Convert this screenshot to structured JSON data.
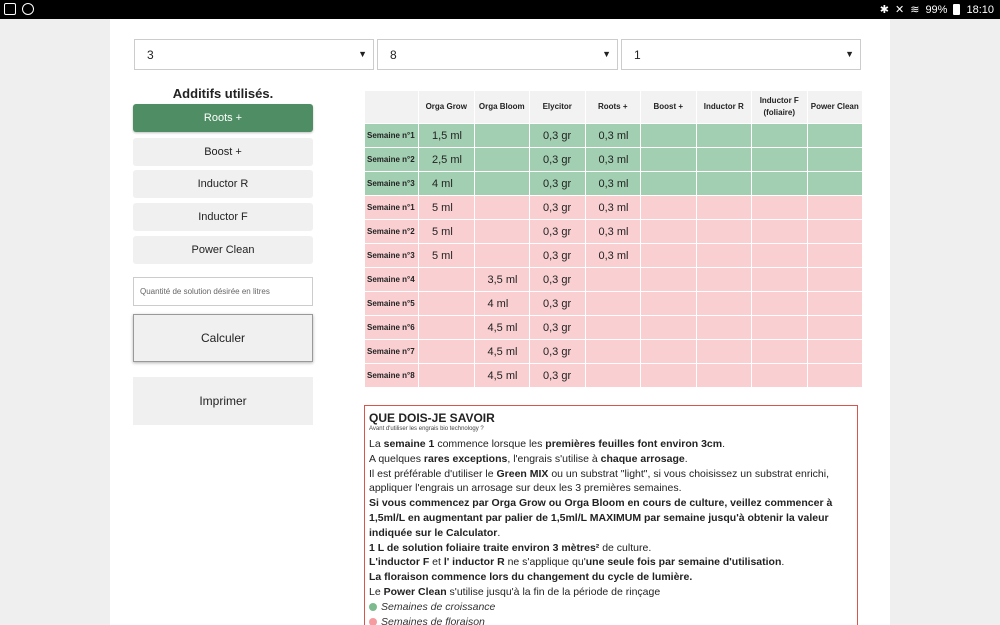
{
  "status_bar": {
    "battery": "99%",
    "time": "18:10"
  },
  "selects": {
    "s1": "3",
    "s2": "8",
    "s3": "1"
  },
  "sidebar": {
    "title": "Additifs utilisés.",
    "buttons": [
      "Roots +",
      "Boost +",
      "Inductor R",
      "Inductor F",
      "Power Clean"
    ],
    "active_index": 0,
    "quantity_placeholder": "Quantité de solution désirée en litres",
    "calculate_label": "Calculer",
    "print_label": "Imprimer"
  },
  "table": {
    "headers": [
      "Orga Grow",
      "Orga Bloom",
      "Elycitor",
      "Roots +",
      "Boost +",
      "Inductor R",
      "Inductor F (foliaire)",
      "Power Clean"
    ],
    "rows": [
      {
        "phase": "grow",
        "week": "Semaine n°1",
        "cells": [
          "1,5 ml",
          "",
          "0,3 gr",
          "0,3 ml",
          "",
          "",
          "",
          ""
        ]
      },
      {
        "phase": "grow",
        "week": "Semaine n°2",
        "cells": [
          "2,5 ml",
          "",
          "0,3 gr",
          "0,3 ml",
          "",
          "",
          "",
          ""
        ]
      },
      {
        "phase": "grow",
        "week": "Semaine n°3",
        "cells": [
          "4 ml",
          "",
          "0,3 gr",
          "0,3 ml",
          "",
          "",
          "",
          ""
        ]
      },
      {
        "phase": "flower",
        "week": "Semaine n°1",
        "cells": [
          "5 ml",
          "",
          "0,3 gr",
          "0,3 ml",
          "",
          "",
          "",
          ""
        ]
      },
      {
        "phase": "flower",
        "week": "Semaine n°2",
        "cells": [
          "5 ml",
          "",
          "0,3 gr",
          "0,3 ml",
          "",
          "",
          "",
          ""
        ]
      },
      {
        "phase": "flower",
        "week": "Semaine n°3",
        "cells": [
          "5 ml",
          "",
          "0,3 gr",
          "0,3 ml",
          "",
          "",
          "",
          ""
        ]
      },
      {
        "phase": "flower",
        "week": "Semaine n°4",
        "cells": [
          "",
          "3,5 ml",
          "0,3 gr",
          "",
          "",
          "",
          "",
          ""
        ]
      },
      {
        "phase": "flower",
        "week": "Semaine n°5",
        "cells": [
          "",
          "4 ml",
          "0,3 gr",
          "",
          "",
          "",
          "",
          ""
        ]
      },
      {
        "phase": "flower",
        "week": "Semaine n°6",
        "cells": [
          "",
          "4,5 ml",
          "0,3 gr",
          "",
          "",
          "",
          "",
          ""
        ]
      },
      {
        "phase": "flower",
        "week": "Semaine n°7",
        "cells": [
          "",
          "4,5 ml",
          "0,3 gr",
          "",
          "",
          "",
          "",
          ""
        ]
      },
      {
        "phase": "flower",
        "week": "Semaine n°8",
        "cells": [
          "",
          "4,5 ml",
          "0,3 gr",
          "",
          "",
          "",
          "",
          ""
        ]
      }
    ]
  },
  "info": {
    "title": "QUE DOIS-JE SAVOIR",
    "subtitle": "Avant d'utiliser les engrais bio technology ?",
    "l1": [
      "La ",
      "semaine 1",
      " commence lorsque les ",
      "premières feuilles font environ 3cm",
      "."
    ],
    "l2": [
      "A quelques ",
      "rares exceptions",
      ", l'engrais s'utilise à ",
      "chaque arrosage",
      "."
    ],
    "l3": [
      "Il est préférable d'utiliser le ",
      "Green MIX",
      " ou un substrat \"light\", si vous choisissez un substrat enrichi, appliquer l'engrais un arrosage sur deux les 3 premières semaines."
    ],
    "l4": [
      "Si vous commencez par Orga Grow ou Orga Bloom en cours de culture, veillez commencer à 1,5ml/L en augmentant par palier de 1,5ml/L MAXIMUM par semaine jusqu'à obtenir la valeur indiquée sur le Calculator",
      "."
    ],
    "l5": [
      "1 L de solution foliaire traite environ 3 mètres²",
      " de culture."
    ],
    "l6": [
      "L'inductor F",
      " et ",
      "l' inductor R",
      " ne s'applique qu'",
      "une seule fois par semaine d'utilisation",
      "."
    ],
    "l7": "La floraison commence lors du changement du cycle de lumière.",
    "l8": [
      "Le ",
      "Power Clean",
      " s'utilise jusqu'à la fin de la période de rinçage"
    ],
    "legend_grow": "Semaines de croissance",
    "legend_flower": "Semaines de floraison"
  },
  "colors": {
    "grow": "#a2cfb2",
    "flower": "#f9cfd1",
    "active_button": "#4f8e64",
    "info_border": "#d9534f"
  }
}
